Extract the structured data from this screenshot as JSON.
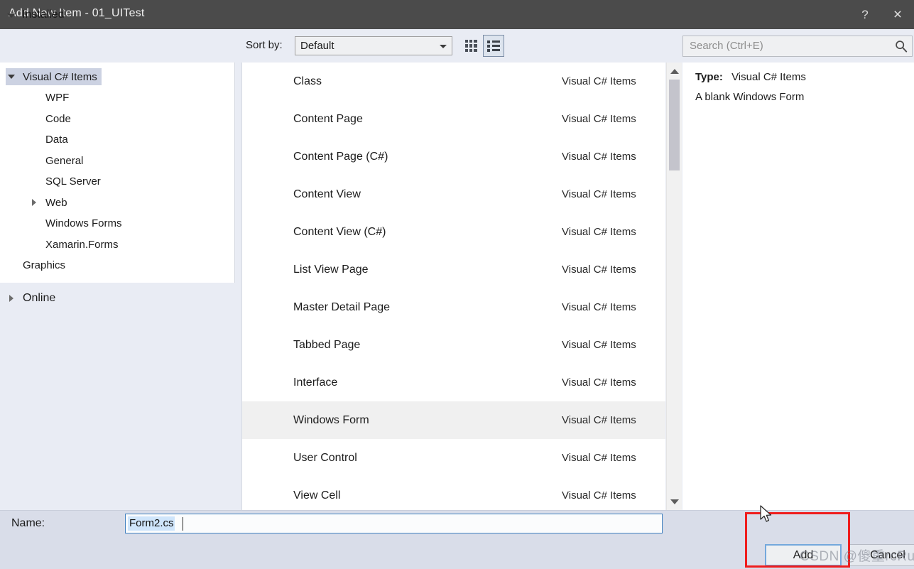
{
  "window": {
    "title": "Add New Item - 01_UITest",
    "help_label": "?",
    "close_label": "×"
  },
  "toolbar": {
    "installed_label": "Installed",
    "sort_by_label": "Sort by:",
    "sort_by_value": "Default",
    "tiles_view_icon": "grid-tiles-icon",
    "list_view_icon": "list-view-icon"
  },
  "search": {
    "placeholder": "Search (Ctrl+E)",
    "icon": "search-icon"
  },
  "tree": {
    "root_label": "Installed",
    "nodes": [
      {
        "label": "Visual C# Items",
        "indent": 0,
        "expander": "down",
        "selected": true
      },
      {
        "label": "WPF",
        "indent": 1,
        "expander": "none",
        "selected": false
      },
      {
        "label": "Code",
        "indent": 1,
        "expander": "none",
        "selected": false
      },
      {
        "label": "Data",
        "indent": 1,
        "expander": "none",
        "selected": false
      },
      {
        "label": "General",
        "indent": 1,
        "expander": "none",
        "selected": false
      },
      {
        "label": "SQL Server",
        "indent": 1,
        "expander": "none",
        "selected": false
      },
      {
        "label": "Web",
        "indent": 1,
        "expander": "right",
        "selected": false
      },
      {
        "label": "Windows Forms",
        "indent": 1,
        "expander": "none",
        "selected": false
      },
      {
        "label": "Xamarin.Forms",
        "indent": 1,
        "expander": "none",
        "selected": false
      },
      {
        "label": "Graphics",
        "indent": 0,
        "expander": "none",
        "selected": false
      }
    ],
    "online_label": "Online"
  },
  "list": {
    "items": [
      {
        "name": "Class",
        "category": "Visual C# Items",
        "selected": false
      },
      {
        "name": "Content Page",
        "category": "Visual C# Items",
        "selected": false
      },
      {
        "name": "Content Page (C#)",
        "category": "Visual C# Items",
        "selected": false
      },
      {
        "name": "Content View",
        "category": "Visual C# Items",
        "selected": false
      },
      {
        "name": "Content View (C#)",
        "category": "Visual C# Items",
        "selected": false
      },
      {
        "name": "List View Page",
        "category": "Visual C# Items",
        "selected": false
      },
      {
        "name": "Master Detail Page",
        "category": "Visual C# Items",
        "selected": false
      },
      {
        "name": "Tabbed Page",
        "category": "Visual C# Items",
        "selected": false
      },
      {
        "name": "Interface",
        "category": "Visual C# Items",
        "selected": false
      },
      {
        "name": "Windows Form",
        "category": "Visual C# Items",
        "selected": true
      },
      {
        "name": "User Control",
        "category": "Visual C# Items",
        "selected": false
      },
      {
        "name": "View Cell",
        "category": "Visual C# Items",
        "selected": false
      }
    ]
  },
  "details": {
    "type_label": "Type:",
    "type_value": "Visual C# Items",
    "description": "A blank Windows Form"
  },
  "bottom": {
    "name_label": "Name:",
    "name_value": "Form2.cs",
    "add_label": "Add",
    "cancel_label": "Cancel"
  },
  "overlay": {
    "watermark": "CSDN @傻重rcRu",
    "highlight_color": "#ef1d1d",
    "cursor": "mouse-pointer-icon"
  }
}
